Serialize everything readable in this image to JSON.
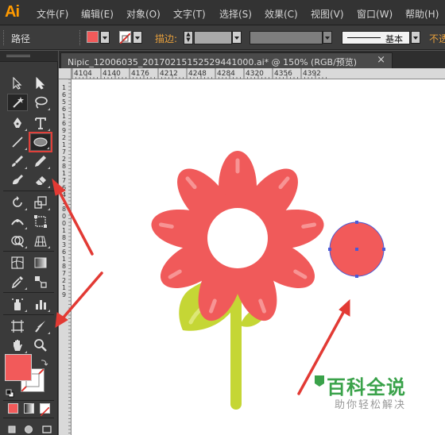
{
  "app": {
    "logo": "Ai",
    "menu": [
      "文件(F)",
      "编辑(E)",
      "对象(O)",
      "文字(T)",
      "选择(S)",
      "效果(C)",
      "视图(V)",
      "窗口(W)",
      "帮助(H)"
    ]
  },
  "control_bar": {
    "selection_label": "路径",
    "stroke_label": "描边:",
    "stroke_style": "基本",
    "opacity_label": "不透"
  },
  "document": {
    "tab_title": "Nipic_12006035_20170215152529441000.ai* @ 150% (RGB/预览)",
    "close_glyph": "×"
  },
  "rulers": {
    "h_labels": [
      "4104",
      "4140",
      "4176",
      "4212",
      "4248",
      "4284",
      "4320",
      "4356",
      "4392"
    ],
    "v_labels": [
      "1",
      "6",
      "5",
      "6",
      "1",
      "6",
      "9",
      "2",
      "1",
      "7",
      "2",
      "8",
      "1",
      "7",
      "6",
      "4",
      "1",
      "8",
      "0",
      "0",
      "1",
      "8",
      "3",
      "6",
      "1",
      "8",
      "7",
      "2",
      "1",
      "9"
    ]
  },
  "tools": {
    "active": "selection-tool",
    "highlighted": "ellipse-tool"
  },
  "colors": {
    "fill": "#f25a5a",
    "flower_petal": "#f05a5a",
    "flower_petal_highlight": "#f48a8a",
    "stem": "#c5d635",
    "selection": "#4a5ad6",
    "annotation_arrow": "#e23a34"
  },
  "watermark": {
    "title": "百科全说",
    "subtitle": "助你轻松解决"
  }
}
